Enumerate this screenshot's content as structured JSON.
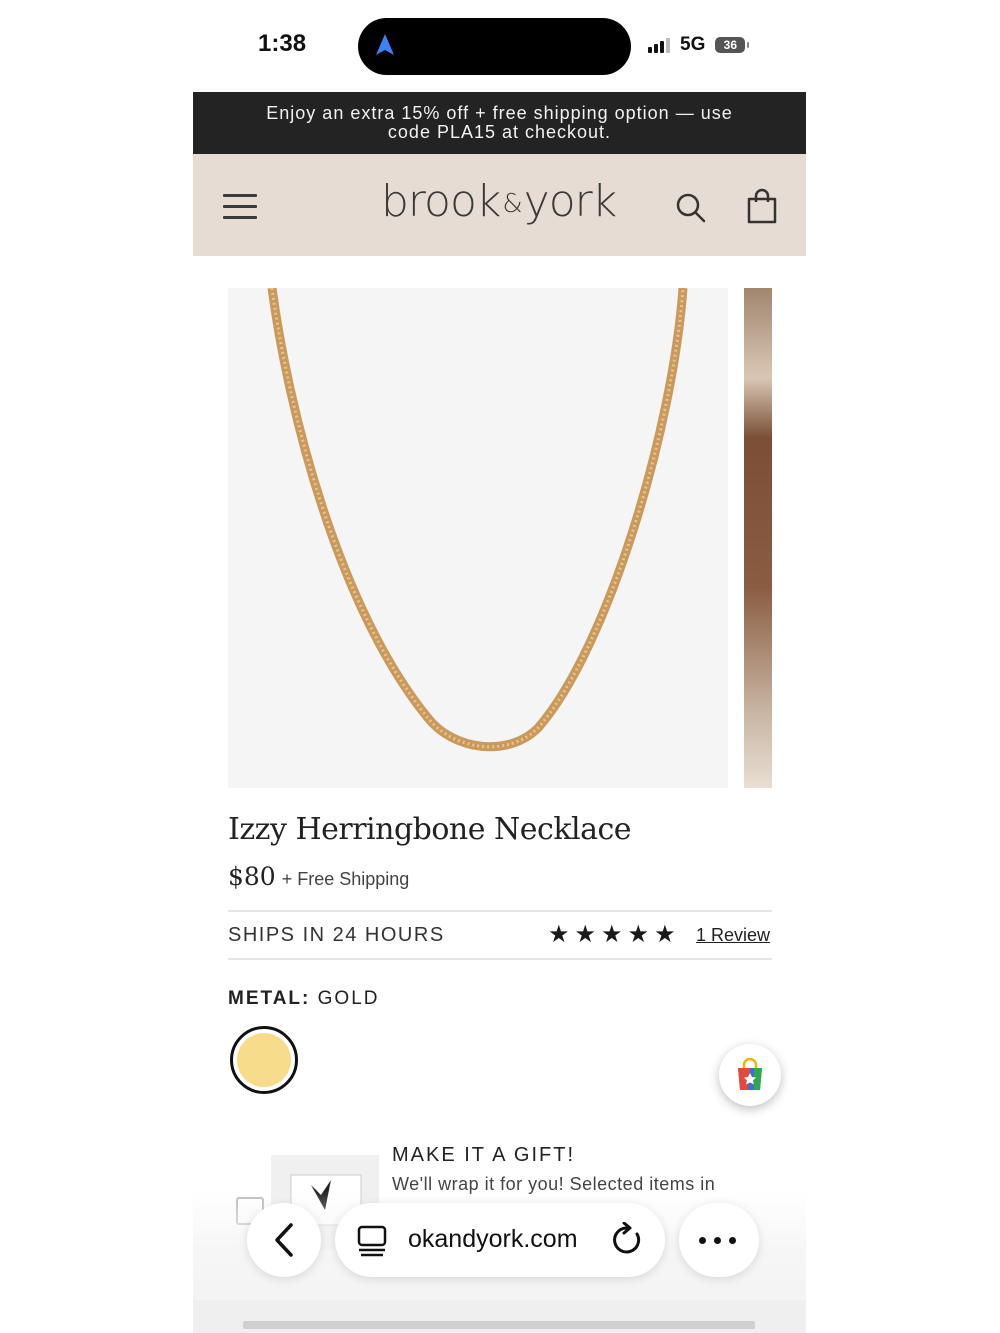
{
  "status_bar": {
    "time": "1:38",
    "network": "5G",
    "battery": "36"
  },
  "promo": {
    "line1": "Enjoy an extra 15% off + free shipping option — use",
    "line2": "code PLA15 at checkout."
  },
  "header": {
    "logo_left": "brook",
    "logo_amp": "&",
    "logo_right": "york"
  },
  "product": {
    "title": "Izzy Herringbone Necklace",
    "price": "$80",
    "shipping_note": "+ Free Shipping",
    "ships_text": "SHIPS IN 24 HOURS",
    "rating_stars": 5,
    "review_link": "1 Review",
    "metal_label": "METAL:",
    "metal_value": "GOLD",
    "swatch_color": "#f7dc8b"
  },
  "gift": {
    "title": "MAKE IT A GIFT!",
    "description": "We'll wrap it for you! Selected items in"
  },
  "browser": {
    "url": "okandyork.com"
  },
  "icons": {
    "menu": "hamburger-menu-icon",
    "search": "search-icon",
    "cart": "shopping-bag-icon",
    "back": "chevron-left-icon",
    "tabs": "tabs-icon",
    "reload": "reload-icon",
    "more": "more-dots-icon"
  }
}
